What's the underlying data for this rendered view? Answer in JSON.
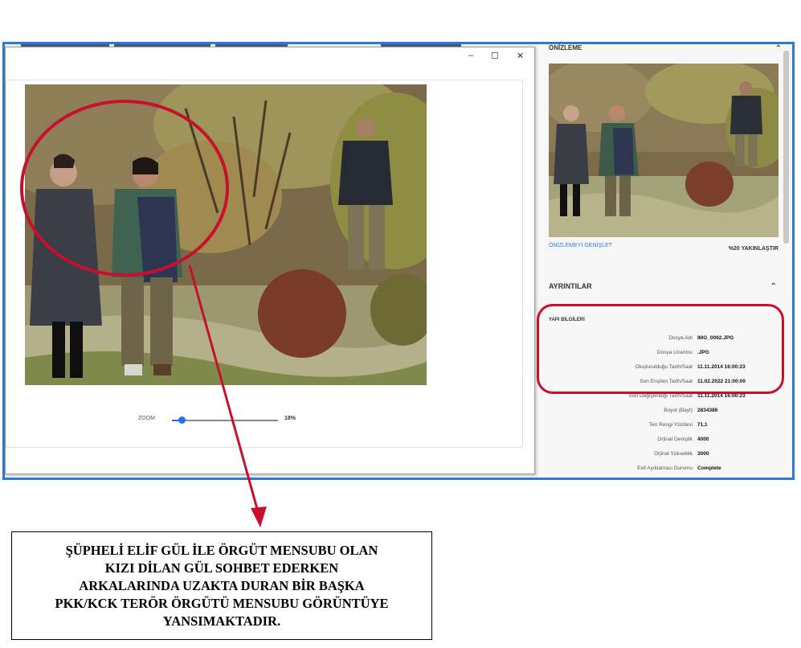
{
  "viewer": {
    "window_controls": {
      "minimize": "–",
      "maximize": "☐",
      "close": "✕"
    },
    "zoom": {
      "label": "ZOOM",
      "value_text": "18%",
      "level": 0.18
    }
  },
  "preview_panel": {
    "title": "ÖNİZLEME",
    "collapse_icon": "⌃",
    "expand_link": "ÖNİZLEMEYİ GENİŞLET",
    "zoom_text": "%20 YAKINLAŞTIR"
  },
  "details_panel": {
    "title": "AYRINTILAR",
    "collapse_icon": "⌃",
    "section": "YAPI BİLGİLERİ",
    "rows": [
      {
        "key": "Dosya Adı",
        "value": "IMG_0092.JPG"
      },
      {
        "key": "Dosya Uzantısı",
        "value": ".JPG"
      },
      {
        "key": "Oluşturulduğu Tarih/Saat",
        "value": "11.11.2014 16:00:23"
      },
      {
        "key": "Son Erişilen Tarih/Saat",
        "value": "11.02.2022 21:00:00"
      },
      {
        "key": "Son Değiştirildiği Tarih/Saat",
        "value": "11.11.2014 16:00:23"
      },
      {
        "key": "Boyut (Bayt)",
        "value": "2834386"
      },
      {
        "key": "Ten Rengi Yüzdesi",
        "value": "71,1"
      },
      {
        "key": "Orjinal Genişlik",
        "value": "4000"
      },
      {
        "key": "Orjinal Yükseklik",
        "value": "3000"
      },
      {
        "key": "Exif Ayıklaması Durumu",
        "value": "Complete"
      }
    ]
  },
  "annotation": {
    "caption_lines": [
      "ŞÜPHELİ ELİF GÜL İLE ÖRGÜT MENSUBU OLAN",
      "KIZI DİLAN GÜL SOHBET EDERKEN",
      "ARKALARINDA UZAKTA DURAN BİR BAŞKA",
      "PKK/KCK TERÖR ÖRGÜTÜ MENSUBU GÖRÜNTÜYE",
      "YANSIMAKTADIR."
    ],
    "highlight_color": "#c8102e"
  },
  "colors": {
    "frame_border": "#2f7ad1",
    "accent": "#1a73e8",
    "annotation": "#c8102e"
  }
}
